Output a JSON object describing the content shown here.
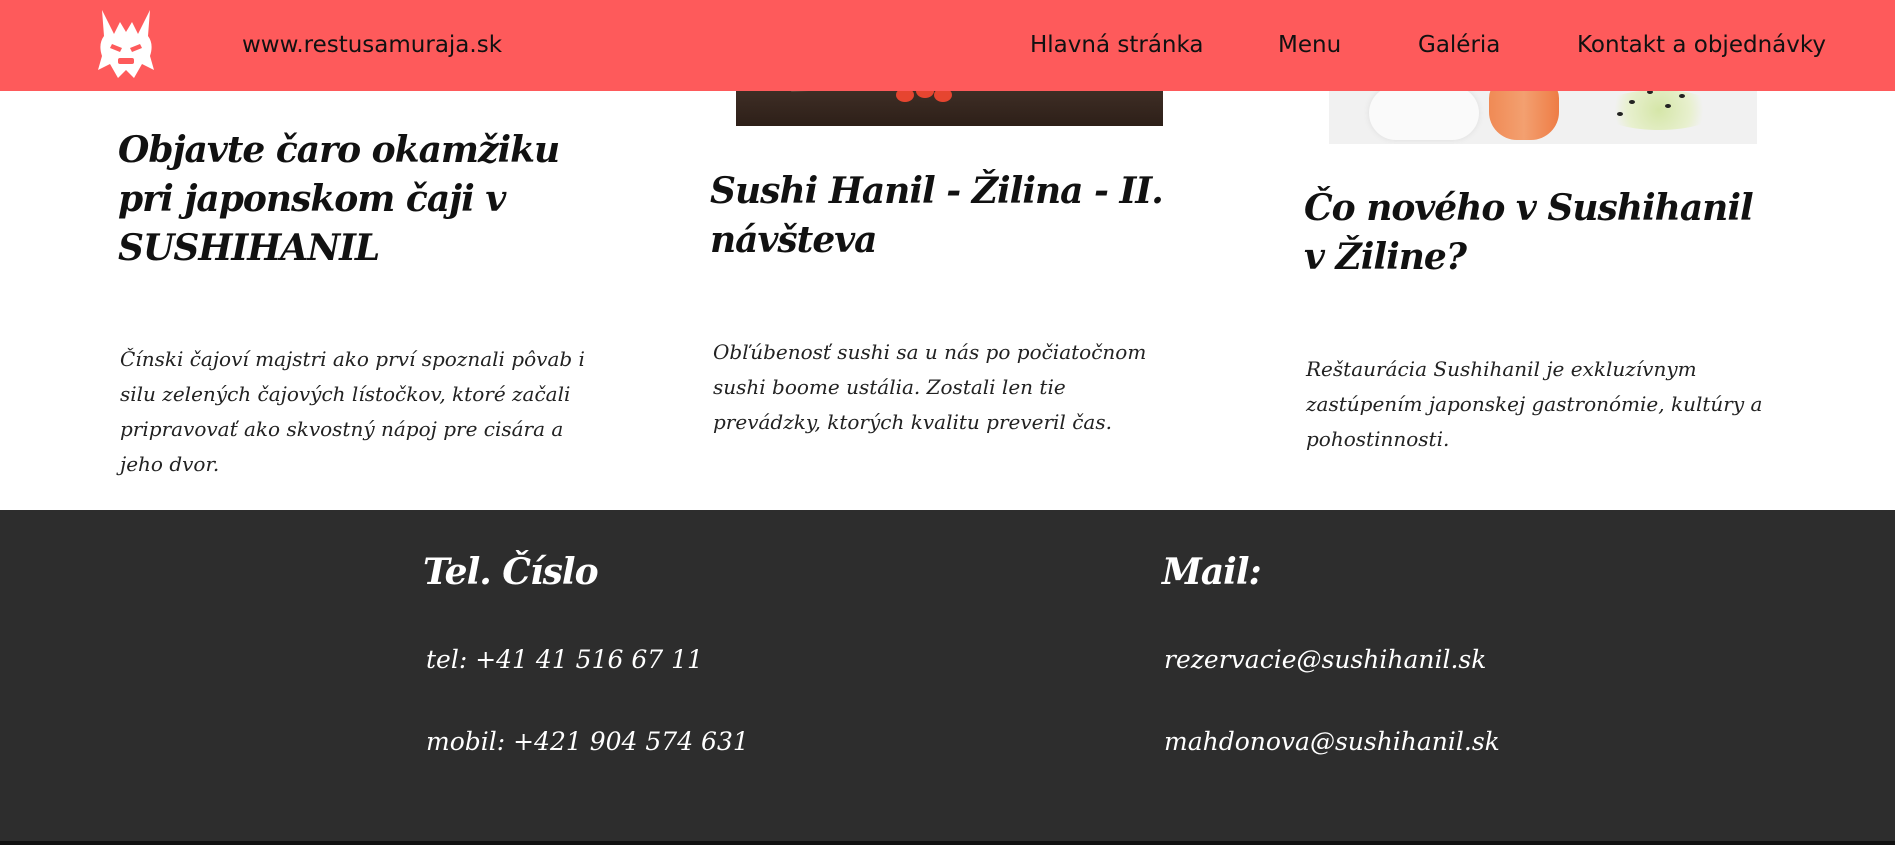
{
  "header": {
    "site_url": "www.restusamuraja.sk",
    "logo_icon": "samurai-helmet-icon",
    "nav": [
      {
        "label": "Hlavná stránka"
      },
      {
        "label": "Menu"
      },
      {
        "label": "Galéria"
      },
      {
        "label": "Kontakt a objednávky"
      }
    ]
  },
  "colors": {
    "header_bg": "#fe5a5b",
    "footer_bg": "#2d2d2d",
    "text": "#111111"
  },
  "articles": [
    {
      "title": "Objavte čaro okamžiku pri japonskom čaji v SUSHIHANIL",
      "text": "Čínski čajoví majstri ako prví spoznali pôvab i silu zelených čajových lístočkov, ktoré začali pripravovať ako skvostný nápoj pre cisára a jeho dvor."
    },
    {
      "title": "Sushi Hanil - Žilina - II. návšteva",
      "text": "Obľúbenosť sushi sa u nás po počiatočnom sushi boome ustália. Zostali len tie prevádzky, ktorých kvalitu preveril čas."
    },
    {
      "title": "Čo nového v Sushihanil v Žiline?",
      "text": "Reštaurácia Sushihanil je exkluzívnym zastúpením japonskej gastronómie, kultúry a pohostinnosti."
    }
  ],
  "footer": {
    "phone_heading": "Tel. Číslo",
    "phone_tel": "tel: +41 41 516 67 11",
    "phone_mobile": "mobil: +421 904 574 631",
    "mail_heading": "Mail:",
    "mail_1": "rezervacie@sushihanil.sk",
    "mail_2": "mahdonova@sushihanil.sk"
  }
}
